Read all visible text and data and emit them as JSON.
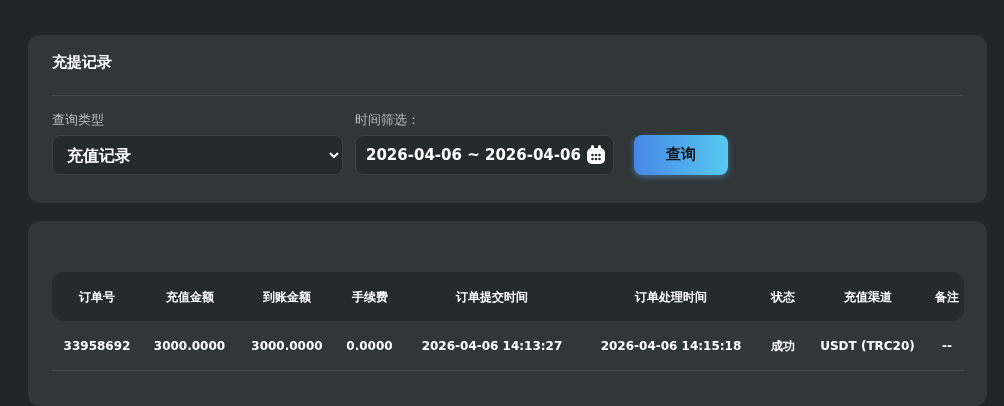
{
  "filter_card": {
    "title": "充提记录",
    "query_type": {
      "label": "查询类型",
      "value": "充值记录"
    },
    "date_filter": {
      "label": "时间筛选：",
      "value": "2026-04-06 ~ 2026-04-06"
    },
    "search_button": "查询"
  },
  "table": {
    "columns": [
      "订单号",
      "充值金额",
      "到账金额",
      "手续费",
      "订单提交时间",
      "订单处理时间",
      "状态",
      "充值渠道",
      "备注"
    ],
    "rows": [
      [
        "33958692",
        "3000.0000",
        "3000.0000",
        "0.0000",
        "2026-04-06 14:13:27",
        "2026-04-06 14:15:18",
        "成功",
        "USDT (TRC20)",
        "--"
      ]
    ]
  }
}
